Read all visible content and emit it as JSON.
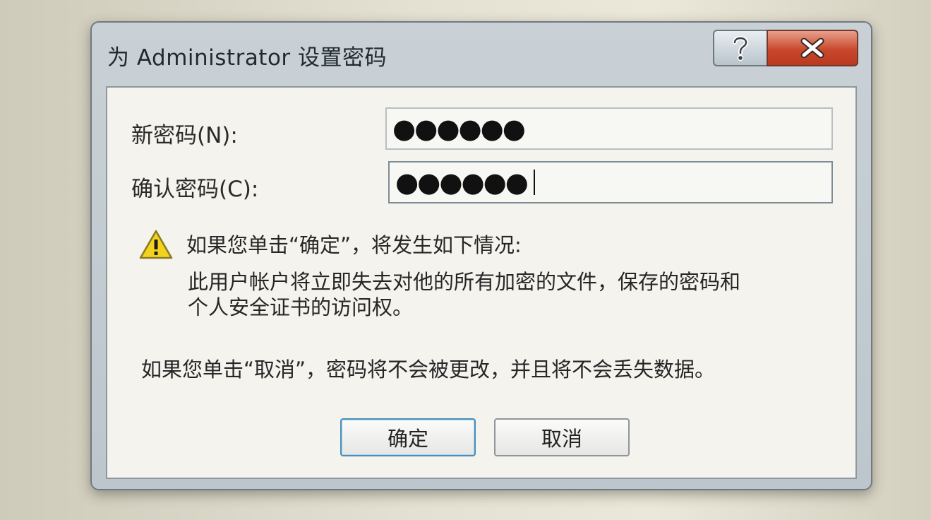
{
  "window": {
    "title": "为 Administrator 设置密码",
    "help_icon": "question-icon",
    "close_icon": "close-x-icon"
  },
  "form": {
    "new_password_label": "新密码(N):",
    "new_password_value": "●●●●●●",
    "confirm_password_label": "确认密码(C):",
    "confirm_password_value": "●●●●●●"
  },
  "warning": {
    "icon": "warning-icon",
    "line1": "如果您单击“确定”，将发生如下情况:",
    "line2": "此用户帐户将立即失去对他的所有加密的文件，保存的密码和",
    "line3": "个人安全证书的访问权。"
  },
  "info": {
    "cancel_note": "如果您单击“取消”，密码将不会被更改，并且将不会丢失数据。"
  },
  "buttons": {
    "ok_label": "确定",
    "cancel_label": "取消"
  },
  "colors": {
    "close_button": "#c9482c",
    "default_button_border": "#4d8fb8",
    "warning_yellow": "#f2d21c"
  }
}
